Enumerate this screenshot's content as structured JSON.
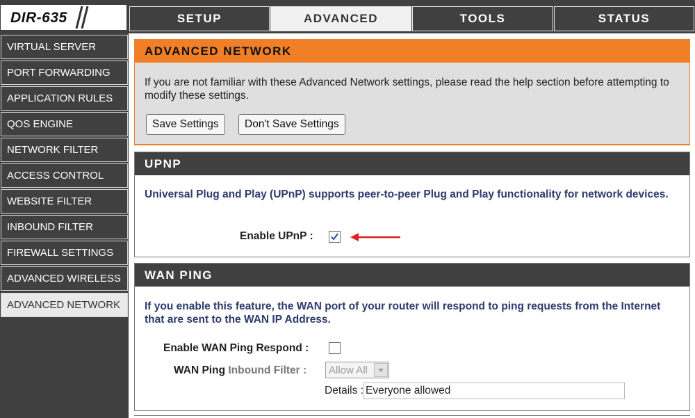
{
  "brand": {
    "model": "DIR-635"
  },
  "tabs": [
    {
      "label": "SETUP",
      "active": false
    },
    {
      "label": "ADVANCED",
      "active": true
    },
    {
      "label": "TOOLS",
      "active": false
    },
    {
      "label": "STATUS",
      "active": false
    }
  ],
  "sidebar": {
    "items": [
      {
        "label": "VIRTUAL SERVER"
      },
      {
        "label": "PORT FORWARDING"
      },
      {
        "label": "APPLICATION RULES"
      },
      {
        "label": "QOS ENGINE"
      },
      {
        "label": "NETWORK FILTER"
      },
      {
        "label": "ACCESS CONTROL"
      },
      {
        "label": "WEBSITE FILTER"
      },
      {
        "label": "INBOUND FILTER"
      },
      {
        "label": "FIREWALL SETTINGS"
      },
      {
        "label": "ADVANCED WIRELESS"
      },
      {
        "label": "ADVANCED NETWORK"
      }
    ],
    "active_item": "ADVANCED NETWORK"
  },
  "advanced_network": {
    "title": "ADVANCED NETWORK",
    "description": "If you are not familiar with these Advanced Network settings, please read the help section before attempting to modify these settings.",
    "save_button": "Save Settings",
    "dont_save_button": "Don't Save Settings"
  },
  "upnp": {
    "title": "UPNP",
    "description": "Universal Plug and Play (UPnP) supports peer-to-peer Plug and Play functionality for network devices.",
    "enable_label": "Enable UPnP :",
    "enabled": true
  },
  "wan_ping": {
    "title": "WAN PING",
    "description": "If you enable this feature, the WAN port of your router will respond to ping requests from the Internet that are sent to the WAN IP Address.",
    "enable_label": "Enable WAN Ping Respond :",
    "enabled": false,
    "inbound_filter_label_part1": "WAN Ping",
    "inbound_filter_label_part2": "Inbound Filter :",
    "inbound_filter_value": "Allow All",
    "details_label": "Details :",
    "details_value": "Everyone allowed"
  },
  "colors": {
    "dark_gray": "#404040",
    "orange": "#f07f27",
    "navy_text": "#2d3b6e",
    "arrow_red": "#e02020"
  },
  "icons": {
    "upnp_arrow": "left-arrow-icon",
    "select_caret": "chevron-down-icon"
  }
}
